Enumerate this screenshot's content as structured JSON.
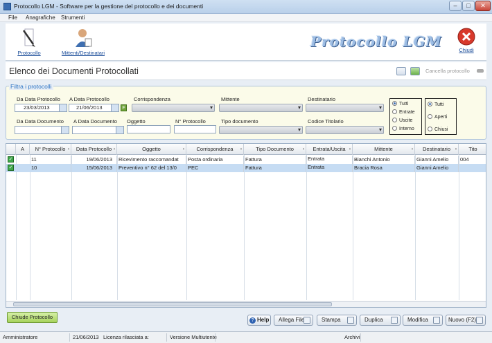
{
  "window": {
    "title": "Protocollo LGM - Software per la gestione del protocollo e dei documenti"
  },
  "menu": [
    "File",
    "Anagrafiche",
    "Strumenti"
  ],
  "toolbar": {
    "protocollo": "Protocollo",
    "mittenti": "Mittenti/Destinatari",
    "brand": "Protocollo LGM",
    "chiudi": "Chiudi"
  },
  "page": {
    "title": "Elenco dei Documenti Protocollati",
    "cancella": "Cancella protocollo"
  },
  "filter": {
    "legend": "Filtra i protocolli",
    "da_data_protocollo": "Da Data Protocollo",
    "a_data_protocollo": "A Data Protocollo",
    "da_data_protocollo_value": "23/03/2013",
    "a_data_protocollo_value": "21/06/2013",
    "f_button": "F",
    "corrispondenza": "Corrispondenza",
    "mittente": "Mittente",
    "destinatario": "Destinatario",
    "da_data_documento": "Da Data Documento",
    "a_data_documento": "A Data Documento",
    "oggetto": "Oggetto",
    "n_protocollo": "N° Protocollo",
    "tipo_documento": "Tipo documento",
    "codice_titolario": "Codice Titolario",
    "direction_options": [
      "Tutti",
      "Entrate",
      "Uscite",
      "Interno"
    ],
    "direction_selected": "Tutti",
    "state_options": [
      "Tutti",
      "Aperti",
      "Chiusi"
    ],
    "state_selected": "Tutti"
  },
  "grid": {
    "columns": [
      "A",
      "N° Protocollo",
      "Data Protocollo",
      "Oggetto",
      "Corrispondenza",
      "Tipo Documento",
      "Entrata/Uscita",
      "Mittente",
      "Destinatario",
      "Tito"
    ],
    "rows": [
      {
        "n": "11",
        "data": "19/06/2013",
        "oggetto": "Ricevimento raccomandat",
        "corrispondenza": "Posta ordinaria",
        "tipo": "Fattura",
        "eu": "Entrata",
        "mittente": "Bianchi Antonio",
        "destinatario": "Gianni Amelio",
        "tito": "004"
      },
      {
        "n": "10",
        "data": "15/06/2013",
        "oggetto": "Preventivo n° 62 del 13/0",
        "corrispondenza": "PEC",
        "tipo": "Fattura",
        "eu": "Entrata",
        "mittente": "Bracia Rosa",
        "destinatario": "Gianni Amelio",
        "tito": ""
      }
    ]
  },
  "buttons": {
    "chiudi_protocollo": "Chiude Protocollo",
    "help": "Help",
    "allega": "Allega File",
    "stampa": "Stampa",
    "duplica": "Duplica",
    "modifica": "Modifica",
    "nuovo": "Nuovo (F2)"
  },
  "status": {
    "user": "Amministratore",
    "date": "21/06/2013",
    "licenza": "Licenza rilasciata a:",
    "versione": "Versione Multiutente",
    "archivi": "Archivi"
  }
}
